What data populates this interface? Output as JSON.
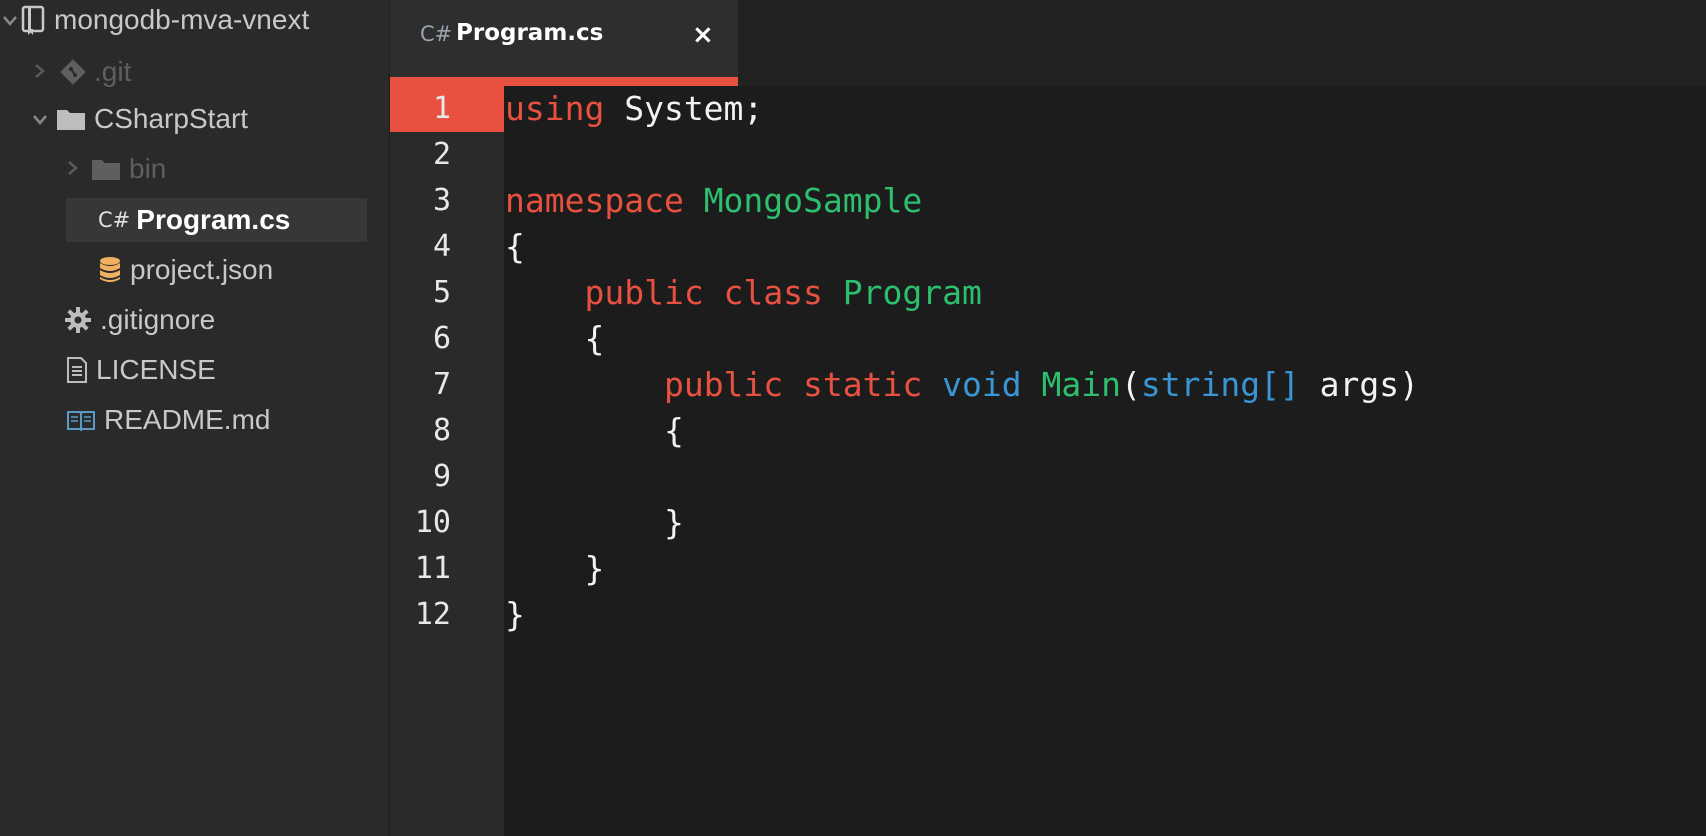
{
  "sidebar": {
    "root": {
      "label": "mongodb-mva-vnext",
      "icon": "repo-icon"
    },
    "items": [
      {
        "label": ".git",
        "icon": "git-icon",
        "expanded": false
      },
      {
        "label": "CSharpStart",
        "icon": "folder-icon",
        "expanded": true
      },
      {
        "label": "bin",
        "icon": "folder-icon",
        "expanded": false
      },
      {
        "label": "Program.cs",
        "icon": "csharp-icon",
        "icon_text": "C#",
        "selected": true
      },
      {
        "label": "project.json",
        "icon": "database-icon"
      },
      {
        "label": ".gitignore",
        "icon": "gear-icon"
      },
      {
        "label": "LICENSE",
        "icon": "document-icon"
      },
      {
        "label": "README.md",
        "icon": "book-icon"
      }
    ]
  },
  "tab": {
    "icon_text": "C#",
    "title": "Program.cs",
    "close": "×"
  },
  "editor": {
    "active_line": "1",
    "line_numbers": [
      "1",
      "2",
      "3",
      "4",
      "5",
      "6",
      "7",
      "8",
      "9",
      "10",
      "11",
      "12"
    ],
    "lines": [
      [
        {
          "t": "kw",
          "v": "using"
        },
        {
          "t": "plain",
          "v": " System;"
        }
      ],
      [],
      [
        {
          "t": "kw",
          "v": "namespace"
        },
        {
          "t": "plain",
          "v": " "
        },
        {
          "t": "type",
          "v": "MongoSample"
        }
      ],
      [
        {
          "t": "plain",
          "v": "{"
        }
      ],
      [
        {
          "t": "plain",
          "v": "    "
        },
        {
          "t": "kw",
          "v": "public"
        },
        {
          "t": "plain",
          "v": " "
        },
        {
          "t": "kw",
          "v": "class"
        },
        {
          "t": "plain",
          "v": " "
        },
        {
          "t": "type",
          "v": "Program"
        }
      ],
      [
        {
          "t": "plain",
          "v": "    {"
        }
      ],
      [
        {
          "t": "plain",
          "v": "        "
        },
        {
          "t": "kw",
          "v": "public"
        },
        {
          "t": "plain",
          "v": " "
        },
        {
          "t": "kw",
          "v": "static"
        },
        {
          "t": "plain",
          "v": " "
        },
        {
          "t": "blue",
          "v": "void"
        },
        {
          "t": "plain",
          "v": " "
        },
        {
          "t": "type",
          "v": "Main"
        },
        {
          "t": "plain",
          "v": "("
        },
        {
          "t": "blue",
          "v": "string[]"
        },
        {
          "t": "plain",
          "v": " args)"
        }
      ],
      [
        {
          "t": "plain",
          "v": "        {"
        }
      ],
      [],
      [
        {
          "t": "plain",
          "v": "        }"
        }
      ],
      [
        {
          "t": "plain",
          "v": "    }"
        }
      ],
      [
        {
          "t": "plain",
          "v": "}"
        }
      ]
    ]
  },
  "colors": {
    "accent": "#e8503f",
    "keyword": "#e8503f",
    "type": "#2dbf6e",
    "builtin": "#3a95d4",
    "folder": "#bdbdbd",
    "database": "#f0b060",
    "book": "#5a9ac6"
  }
}
